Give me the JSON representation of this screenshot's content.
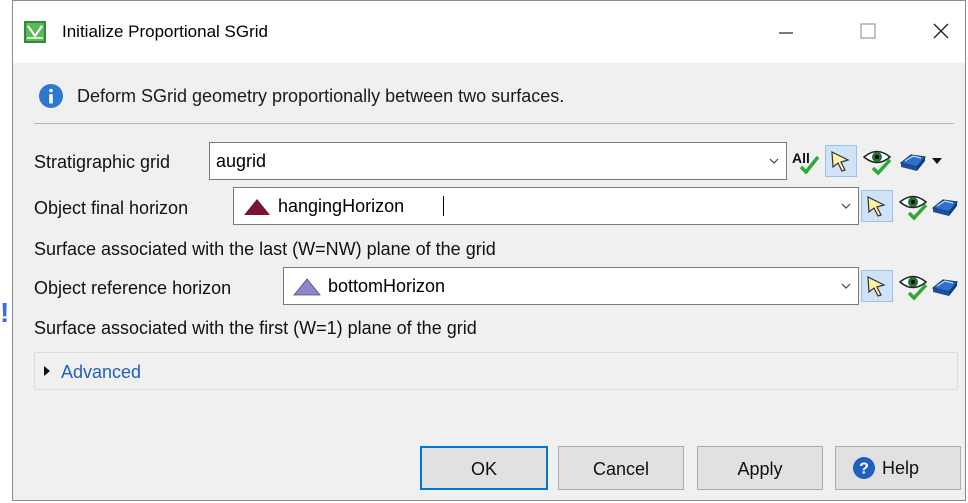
{
  "window": {
    "title": "Initialize Proportional SGrid",
    "controls": {
      "minimize": "minimize-icon",
      "maximize": "maximize-icon",
      "close": "close-icon"
    }
  },
  "info": {
    "icon": "info-icon",
    "text": "Deform SGrid geometry proportionally between two surfaces."
  },
  "form": {
    "strat_grid": {
      "label": "Stratigraphic grid",
      "value": "augrid"
    },
    "final_horizon": {
      "label": "Object final horizon",
      "value": "hangingHorizon",
      "triangle_color": "#7a1530"
    },
    "final_horizon_note": "Surface associated with the last (W=NW) plane of the grid",
    "reference_horizon": {
      "label": "Object reference horizon",
      "value": "bottomHorizon",
      "triangle_color": "#8c87c8"
    },
    "reference_horizon_note": "Surface associated with the first (W=1) plane of the grid"
  },
  "toolbar_icons": {
    "all_label": "All",
    "icons": [
      "select-all-icon",
      "pick-arrow-icon",
      "visibility-eye-icon",
      "surface-object-icon"
    ]
  },
  "advanced": {
    "label": "Advanced"
  },
  "buttons": {
    "ok": "OK",
    "cancel": "Cancel",
    "apply": "Apply",
    "help": "Help"
  },
  "colors": {
    "accent": "#0078d7",
    "link": "#1f5fbf",
    "info_blue": "#2b78d0",
    "check_green": "#2ea836"
  }
}
